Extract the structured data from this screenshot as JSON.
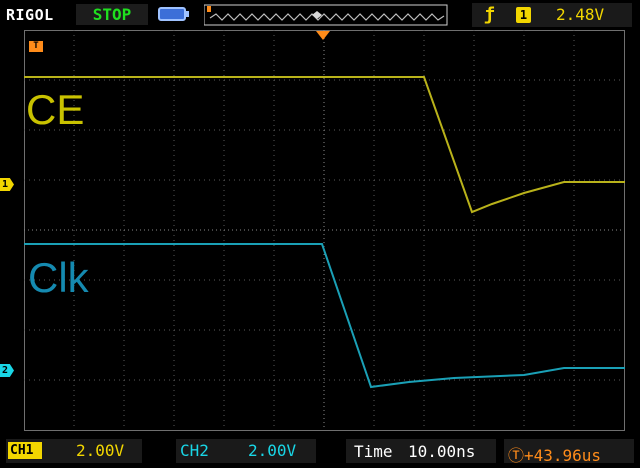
{
  "header": {
    "brand": "RIGOL",
    "run_state": "STOP",
    "trigger_source": "1",
    "trigger_level": "2.48V"
  },
  "markers": {
    "trigger_time": "T",
    "ch1": "1",
    "ch2": "2"
  },
  "traces": {
    "ch1_label": "CE",
    "ch2_label": "Clk"
  },
  "footer": {
    "ch1_tag": "CH1",
    "ch1_scale": "2.00V",
    "ch2_tag": "CH2",
    "ch2_scale": "2.00V",
    "time_label": "Time",
    "time_scale": "10.00ns",
    "trigger_offset": "Ⓣ+43.96us"
  },
  "colors": {
    "ch1": "#c9c200",
    "ch2": "#158ab0",
    "trigger": "#ff8c1a",
    "run_state": "#1fe01f"
  },
  "icons": {
    "battery": "battery-icon",
    "edge": "rising-edge-icon",
    "memory_depth": "waveform-memory-icon"
  }
}
